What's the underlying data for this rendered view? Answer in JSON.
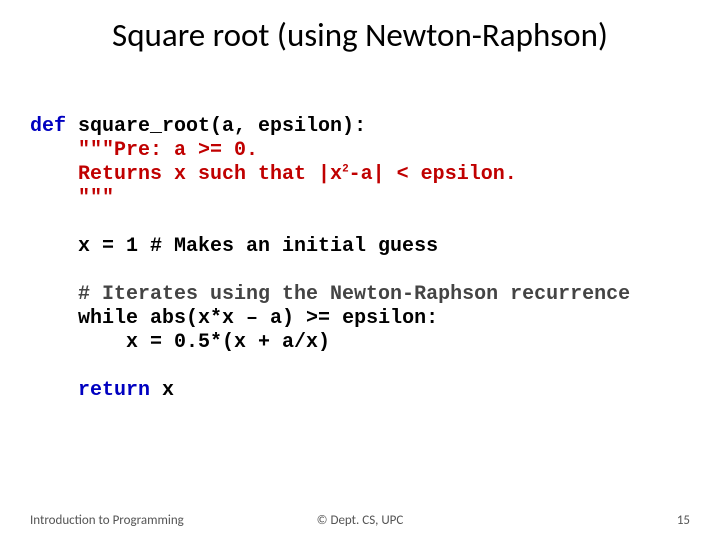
{
  "title": "Square root (using Newton-Raphson)",
  "code": {
    "def_kw": "def",
    "sig": " square_root(a, epsilon):",
    "doc1a": "    \"\"\"Pre: a >= 0.",
    "doc2a": "    Returns x such that |x",
    "doc2sup": "2",
    "doc2b": "-a| < epsilon.",
    "doc3": "    \"\"\"",
    "blank1": " ",
    "guess": "    x = 1 # Makes an initial guess",
    "blank2": " ",
    "iter_comment": "    # Iterates using the Newton-Raphson recurrence",
    "while_kw": "    while",
    "while_cond": " abs(x*x – a) >= epsilon:",
    "update": "        x = 0.5*(x + a/x)",
    "blank3": " ",
    "return_kw": "    return",
    "return_val": " x"
  },
  "footer": {
    "left": "Introduction to Programming",
    "center": "© Dept. CS, UPC",
    "right": "15"
  }
}
